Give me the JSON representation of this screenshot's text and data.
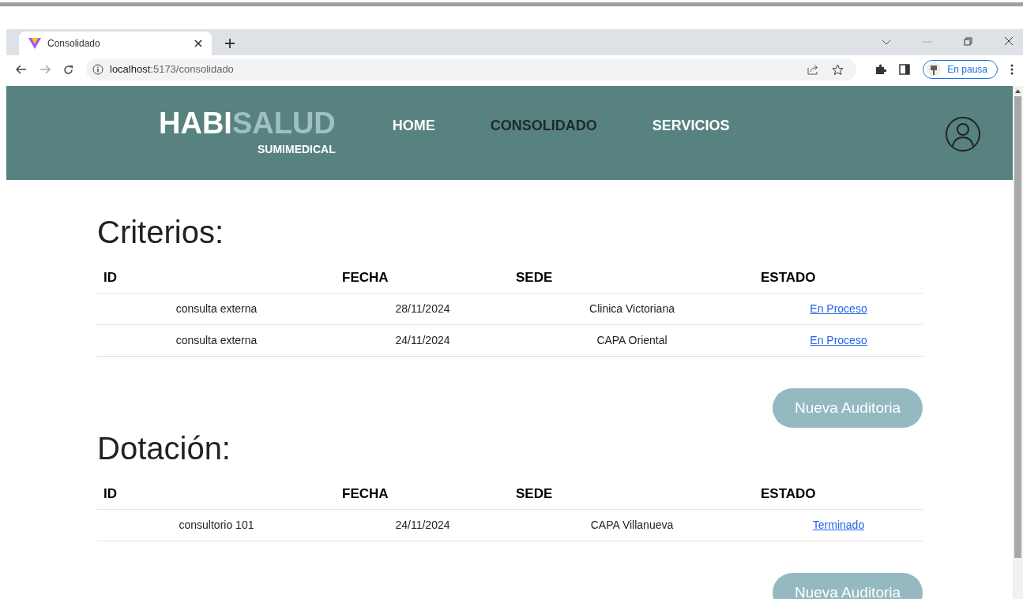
{
  "browser": {
    "tab_title": "Consolidado",
    "url_host": "localhost",
    "url_path": ":5173/consolidado",
    "profile_label": "En pausa"
  },
  "header": {
    "logo_primary": "HABI",
    "logo_secondary": "SALUD",
    "logo_subtitle": "SUMIMEDICAL",
    "nav": [
      {
        "label": "HOME",
        "selected": false
      },
      {
        "label": "CONSOLIDADO",
        "selected": true
      },
      {
        "label": "SERVICIOS",
        "selected": false
      }
    ]
  },
  "sections": [
    {
      "title": "Criterios:",
      "columns": [
        "ID",
        "FECHA",
        "SEDE",
        "ESTADO"
      ],
      "rows": [
        {
          "cells": [
            "consulta externa",
            "28/11/2024",
            "Clinica Victoriana"
          ],
          "status": "En Proceso"
        },
        {
          "cells": [
            "consulta externa",
            "24/11/2024",
            "CAPA Oriental"
          ],
          "status": "En Proceso"
        }
      ],
      "button": "Nueva Auditoria"
    },
    {
      "title": "Dotación:",
      "columns": [
        "ID",
        "FECHA",
        "SEDE",
        "ESTADO"
      ],
      "rows": [
        {
          "cells": [
            "consultorio 101",
            "24/11/2024",
            "CAPA Villanueva"
          ],
          "status": "Terminado"
        }
      ],
      "button": "Nueva Auditoria"
    }
  ]
}
